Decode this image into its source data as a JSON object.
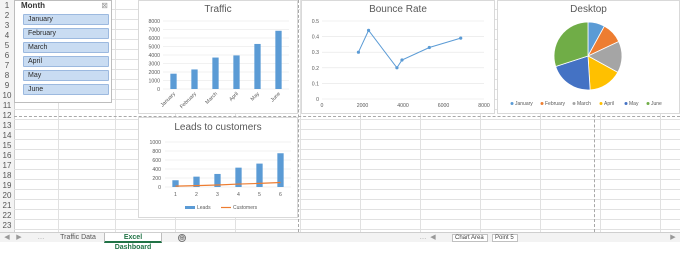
{
  "row_numbers": [
    "1",
    "2",
    "3",
    "4",
    "5",
    "6",
    "7",
    "8",
    "9",
    "10",
    "11",
    "12",
    "13",
    "14",
    "15",
    "16",
    "17",
    "18",
    "19",
    "20",
    "21",
    "22",
    "23"
  ],
  "slicer": {
    "title": "Month",
    "clear_icon": "filter-clear-icon",
    "items": [
      "January",
      "February",
      "March",
      "April",
      "May",
      "June"
    ]
  },
  "charts": {
    "traffic_title": "Traffic",
    "bounce_title": "Bounce Rate",
    "desktop_title": "Desktop",
    "leads_title": "Leads to customers"
  },
  "chart_data": [
    {
      "type": "bar",
      "title": "Traffic",
      "categories": [
        "January",
        "February",
        "March",
        "April",
        "May",
        "June"
      ],
      "values": [
        1800,
        2300,
        3700,
        3950,
        5300,
        6850
      ],
      "ylim": [
        0,
        8000
      ],
      "yticks": [
        "0",
        "1000",
        "2000",
        "3000",
        "4000",
        "5000",
        "6000",
        "7000",
        "8000"
      ],
      "color": "#5b9bd5",
      "grid": true
    },
    {
      "type": "scatter",
      "title": "Bounce Rate",
      "points": [
        [
          1800,
          0.3
        ],
        [
          2300,
          0.44
        ],
        [
          3700,
          0.2
        ],
        [
          3950,
          0.25
        ],
        [
          5300,
          0.33
        ],
        [
          6850,
          0.39
        ]
      ],
      "xlim": [
        0,
        8000
      ],
      "ylim": [
        0,
        0.5
      ],
      "xticks": [
        "0",
        "2000",
        "4000",
        "6000",
        "8000"
      ],
      "yticks": [
        "0",
        "0.1",
        "0.2",
        "0.3",
        "0.4",
        "0.5"
      ],
      "color": "#5b9bd5",
      "grid": true
    },
    {
      "type": "pie",
      "title": "Desktop",
      "labels": [
        "January",
        "February",
        "March",
        "April",
        "May",
        "June"
      ],
      "values": [
        8,
        10,
        15,
        16,
        21,
        30
      ],
      "colors": [
        "#5b9bd5",
        "#ed7d31",
        "#a5a5a5",
        "#ffc000",
        "#4472c4",
        "#70ad47"
      ],
      "legend": "bottom"
    },
    {
      "type": "bar",
      "title": "Leads to customers",
      "categories": [
        "1",
        "2",
        "3",
        "4",
        "5",
        "6"
      ],
      "series": [
        {
          "name": "Leads",
          "type": "bar",
          "values": [
            150,
            230,
            290,
            430,
            520,
            750
          ],
          "color": "#5b9bd5"
        },
        {
          "name": "Customers",
          "type": "line",
          "values": [
            20,
            30,
            45,
            65,
            80,
            100
          ],
          "color": "#ed7d31"
        }
      ],
      "ylim": [
        0,
        1000
      ],
      "yticks": [
        "0",
        "200",
        "400",
        "600",
        "800",
        "1000"
      ],
      "legend": "bottom",
      "grid": true
    }
  ],
  "tabs": {
    "sheet1": "Traffic Data",
    "sheet2": "Excel Dashboard",
    "add": "⊕",
    "nav_prev": "◀",
    "nav_next": "▶",
    "ellipsis": "…"
  },
  "status": {
    "chart_area": "Chart Area",
    "point": "Point 5"
  }
}
